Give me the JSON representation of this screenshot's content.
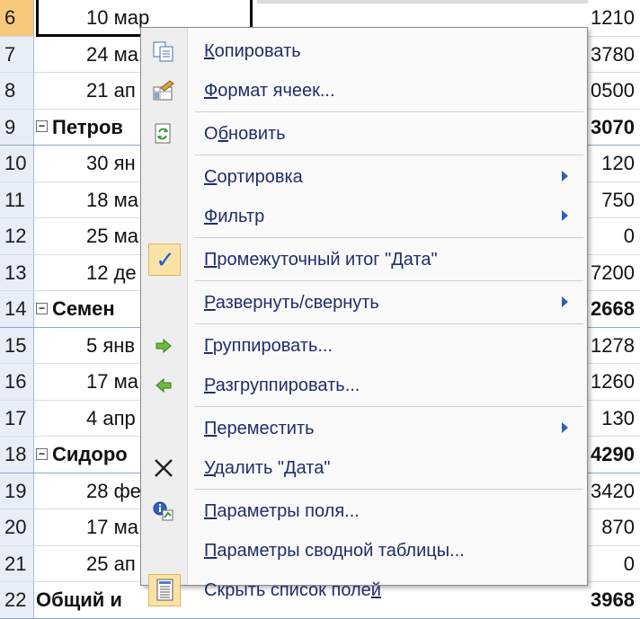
{
  "sheet": {
    "rows": [
      {
        "num": "6",
        "a": "10 мар",
        "b": "1210",
        "level": "date"
      },
      {
        "num": "7",
        "a": "24 ма",
        "b": "3780",
        "level": "date"
      },
      {
        "num": "8",
        "a": "21 ап",
        "b": "0500",
        "level": "date"
      },
      {
        "num": "9",
        "a": "Петров",
        "b": "3070",
        "level": "group"
      },
      {
        "num": "10",
        "a": "30 ян",
        "b": "120",
        "level": "date"
      },
      {
        "num": "11",
        "a": "18 ма",
        "b": "750",
        "level": "date"
      },
      {
        "num": "12",
        "a": "25 ма",
        "b": "0",
        "level": "date"
      },
      {
        "num": "13",
        "a": "12 де",
        "b": "7200",
        "level": "date"
      },
      {
        "num": "14",
        "a": "Семен",
        "b": "2668",
        "level": "group"
      },
      {
        "num": "15",
        "a": "5 янв",
        "b": "1278",
        "level": "date"
      },
      {
        "num": "16",
        "a": "17 ма",
        "b": "1260",
        "level": "date"
      },
      {
        "num": "17",
        "a": "4 апр",
        "b": "130",
        "level": "date"
      },
      {
        "num": "18",
        "a": "Сидоро",
        "b": "4290",
        "level": "group"
      },
      {
        "num": "19",
        "a": "28 фе",
        "b": "3420",
        "level": "date"
      },
      {
        "num": "20",
        "a": "17 ма",
        "b": "870",
        "level": "date"
      },
      {
        "num": "21",
        "a": "25 ап",
        "b": "0",
        "level": "date"
      },
      {
        "num": "22",
        "a": "Общий и",
        "b": "3968",
        "level": "total"
      }
    ],
    "collapse_symbol": "−"
  },
  "menu": {
    "items": [
      {
        "pre": "",
        "key": "К",
        "post": "опировать",
        "icon": "copy-icon",
        "submenu": false
      },
      {
        "pre": "",
        "key": "Ф",
        "post": "ормат ячеек...",
        "icon": "format-cells-icon",
        "submenu": false
      },
      {
        "pre": "О",
        "key": "б",
        "post": "новить",
        "icon": "refresh-icon",
        "submenu": false
      },
      {
        "pre": "",
        "key": "С",
        "post": "ортировка",
        "icon": "",
        "submenu": true
      },
      {
        "pre": "",
        "key": "Ф",
        "post": "ильтр",
        "icon": "",
        "submenu": true
      },
      {
        "pre": "",
        "key": "П",
        "post": "ромежуточный итог \"Дата\"",
        "icon": "checkmark-icon",
        "submenu": false
      },
      {
        "pre": "",
        "key": "Р",
        "post": "азвернуть/свернуть",
        "icon": "",
        "submenu": true
      },
      {
        "pre": "",
        "key": "Г",
        "post": "руппировать...",
        "icon": "group-arrow-icon",
        "submenu": false
      },
      {
        "pre": "",
        "key": "Р",
        "post": "азгруппировать...",
        "icon": "ungroup-arrow-icon",
        "submenu": false
      },
      {
        "pre": "",
        "key": "П",
        "post": "ереместить",
        "icon": "",
        "submenu": true
      },
      {
        "pre": "",
        "key": "У",
        "post": "далить \"Дата\"",
        "icon": "delete-x-icon",
        "submenu": false
      },
      {
        "pre": "",
        "key": "П",
        "post": "араметры поля...",
        "icon": "field-settings-icon",
        "submenu": false
      },
      {
        "pre": "",
        "key": "П",
        "post": "араметры сводной таблицы...",
        "icon": "",
        "submenu": false
      },
      {
        "pre": "Скрыть список поле",
        "key": "й",
        "post": "",
        "icon": "field-list-icon",
        "submenu": false
      }
    ],
    "check_glyph": "✓",
    "delete_glyph": "✕"
  },
  "colors": {
    "menu_text": "#1f2d6b",
    "accent_arrow": "#2d5fb8",
    "highlight": "#fbe3a8",
    "active_row": "#f6c97a"
  }
}
